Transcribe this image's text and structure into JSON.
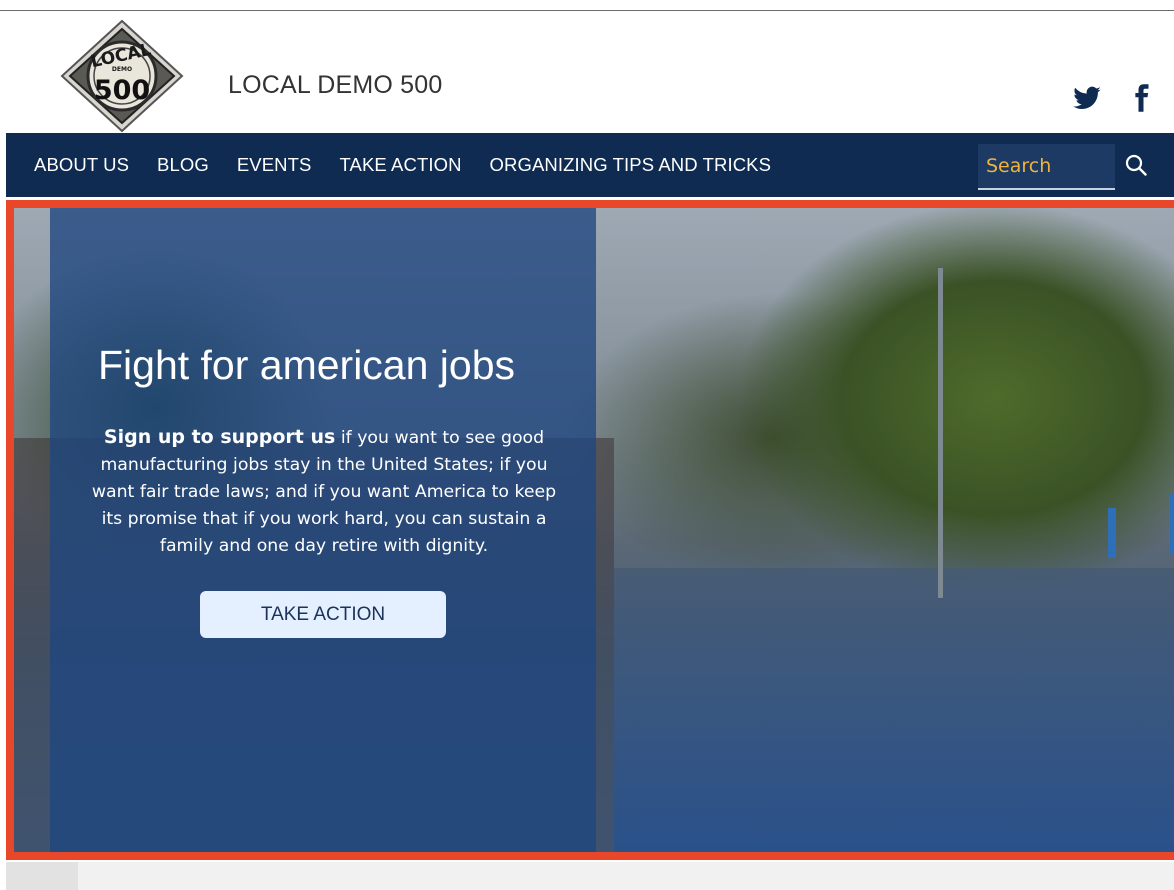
{
  "header": {
    "logo_text": "LOCAL 500",
    "site_title": "LOCAL DEMO 500",
    "social": [
      {
        "name": "twitter-icon"
      },
      {
        "name": "facebook-icon"
      }
    ]
  },
  "nav": {
    "items": [
      {
        "label": "ABOUT US"
      },
      {
        "label": "BLOG"
      },
      {
        "label": "EVENTS"
      },
      {
        "label": "TAKE ACTION"
      },
      {
        "label": "ORGANIZING TIPS AND TRICKS"
      }
    ],
    "search_placeholder": "Search"
  },
  "hero": {
    "heading": "Fight for american jobs",
    "lead_bold": "Sign up to support us",
    "lead_rest": " if you want to see good manufacturing jobs stay in the United States; if you want fair trade laws; and if you want America to keep its promise that if you work hard, you can sustain a family and one day retire with dignity.",
    "button_label": "TAKE ACTION"
  },
  "colors": {
    "nav_bg": "#0f2b52",
    "accent_border": "#e8472a",
    "search_text": "#f0b43c",
    "panel": "#1f4680"
  }
}
